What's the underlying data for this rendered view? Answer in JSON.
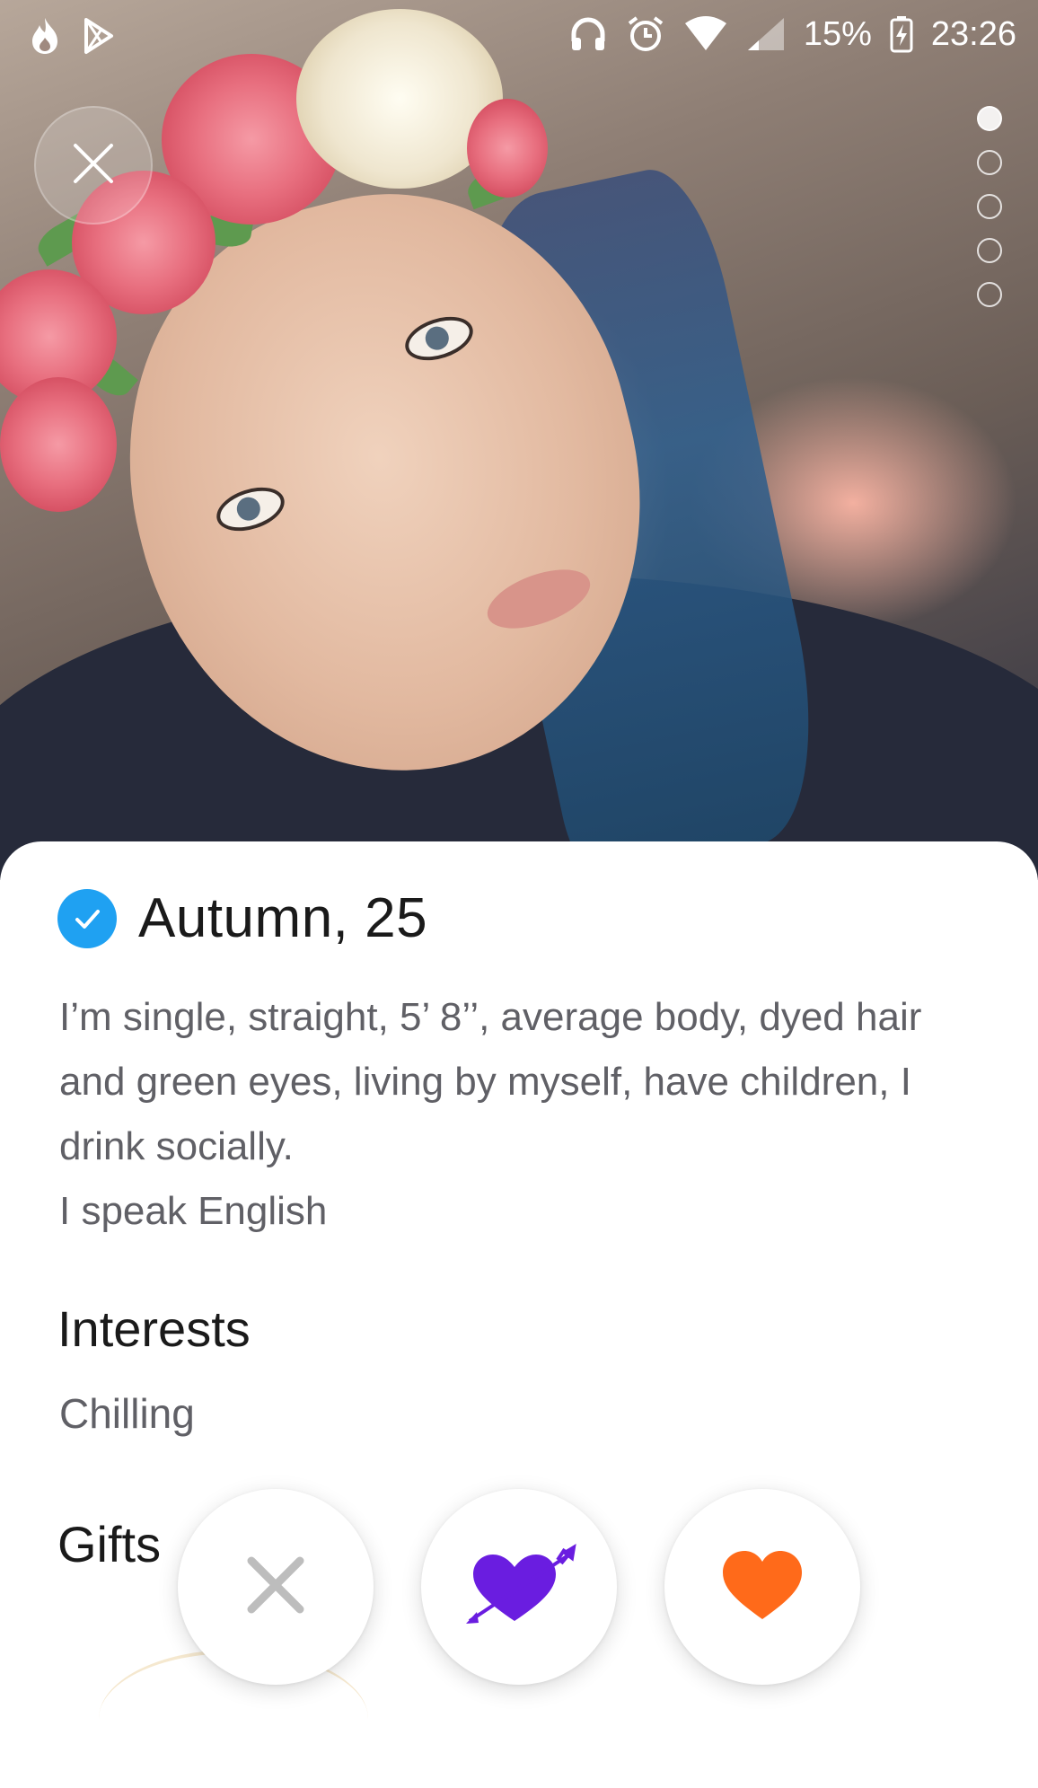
{
  "status_bar": {
    "battery": "15%",
    "time": "23:26",
    "icons_left": [
      "flame-icon",
      "play-store-icon"
    ],
    "icons_right": [
      "headphones-icon",
      "alarm-icon",
      "wifi-icon",
      "signal-icon",
      "battery-charging-icon"
    ]
  },
  "photo": {
    "image_count": 5,
    "current_index": 1,
    "close_icon": "close-icon"
  },
  "profile": {
    "name_age": "Autumn, 25",
    "verified": true,
    "verified_color": "#1fa1f2",
    "about_line1": "I’m single, straight, 5’ 8’’, average body, dyed hair and green eyes, living by myself, have children, I drink socially.",
    "about_line2": "I speak English"
  },
  "interests": {
    "title": "Interests",
    "items": [
      "Chilling"
    ]
  },
  "gifts": {
    "title": "Gifts"
  },
  "actions": {
    "dislike": {
      "icon": "x-icon",
      "color": "#bdbdbd"
    },
    "crush": {
      "icon": "heart-arrow-icon",
      "color": "#6a1de0"
    },
    "like": {
      "icon": "heart-icon",
      "color": "#ff6a1a"
    }
  }
}
